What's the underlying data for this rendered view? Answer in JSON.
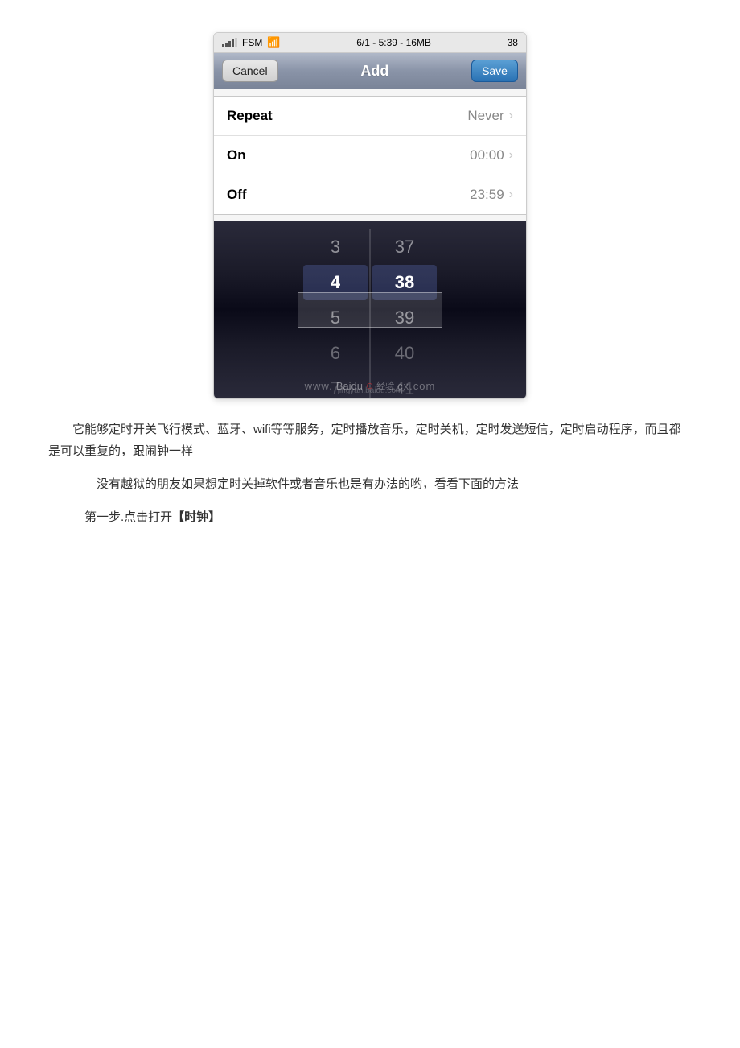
{
  "status_bar": {
    "carrier": "FSM",
    "wifi": true,
    "datetime": "6/1 - 5:39 - 16MB",
    "battery": "38"
  },
  "nav": {
    "cancel_label": "Cancel",
    "title": "Add",
    "save_label": "Save"
  },
  "settings_rows": [
    {
      "label": "Repeat",
      "value": "Never"
    },
    {
      "label": "On",
      "value": "00:00"
    },
    {
      "label": "Off",
      "value": "23:59"
    }
  ],
  "picker": {
    "left_column": [
      "3",
      "4",
      "5",
      "6",
      "7"
    ],
    "right_column": [
      "37",
      "38",
      "39",
      "40",
      "41"
    ],
    "selected_index": 1
  },
  "watermark": {
    "left_text": "www.",
    "brand": "Baidu",
    "brand_sub": "经验",
    "right_text": "cx.com",
    "domain": "jingyan.baidu.com"
  },
  "article": {
    "para1": "它能够定时开关飞行模式、蓝牙、wifi等等服务，定时播放音乐，定时关机，定时发送短信，定时启动程序，而且都是可以重复的，跟闹钟一样",
    "para2": "没有越狱的朋友如果想定时关掉软件或者音乐也是有办法的哟，看看下面的方法",
    "step1_prefix": "第一步.点击打开",
    "step1_bracket": "【时钟】"
  }
}
